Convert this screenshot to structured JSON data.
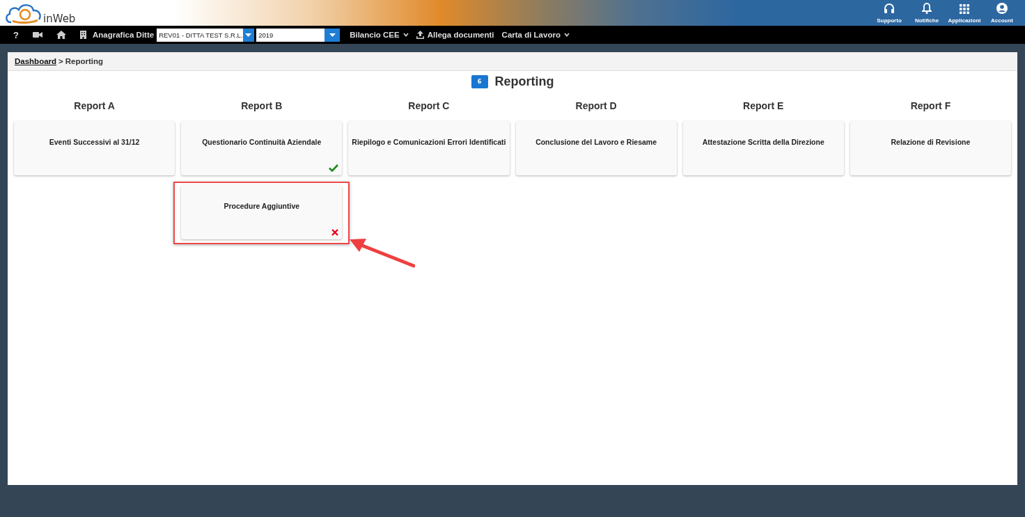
{
  "header": {
    "logo_text": "inWeb",
    "actions": [
      {
        "label": "Supporto",
        "kind": "headset"
      },
      {
        "label": "Notifiche",
        "kind": "bell"
      },
      {
        "label": "Applicazioni",
        "kind": "grid"
      },
      {
        "label": "Account",
        "kind": "account"
      }
    ]
  },
  "navbar": {
    "help": "?",
    "company_label": "Anagrafica Ditte",
    "company_select": "REV01 - DITTA TEST S.R.L.",
    "year_select": "2019",
    "menus": [
      {
        "label": "Bilancio CEE",
        "kind": "dropdown"
      },
      {
        "label": "Allega documenti",
        "kind": "upload"
      },
      {
        "label": "Carta di Lavoro",
        "kind": "dropdown"
      }
    ]
  },
  "breadcrumb": {
    "link": "Dashboard",
    "separator": ">",
    "current": "Reporting"
  },
  "page_title": {
    "badge": "6",
    "title": "Reporting"
  },
  "columns": [
    {
      "heading": "Report A",
      "cards": [
        {
          "title": "Eventi Successivi al 31/12",
          "completed": false,
          "failed": false,
          "highlighted": false
        }
      ]
    },
    {
      "heading": "Report B",
      "cards": [
        {
          "title": "Questionario Continuità Aziendale",
          "completed": true,
          "failed": false,
          "highlighted": false
        },
        {
          "title": "Procedure Aggiuntive",
          "completed": false,
          "failed": true,
          "highlighted": true
        }
      ]
    },
    {
      "heading": "Report C",
      "cards": [
        {
          "title": "Riepilogo e Comunicazioni Errori Identificati",
          "completed": false,
          "failed": false,
          "highlighted": false
        }
      ]
    },
    {
      "heading": "Report D",
      "cards": [
        {
          "title": "Conclusione del Lavoro e Riesame",
          "completed": false,
          "failed": false,
          "highlighted": false
        }
      ]
    },
    {
      "heading": "Report E",
      "cards": [
        {
          "title": "Attestazione Scritta della Direzione",
          "completed": false,
          "failed": false,
          "highlighted": false
        }
      ]
    },
    {
      "heading": "Report F",
      "cards": [
        {
          "title": "Relazione di Revisione",
          "completed": false,
          "failed": false,
          "highlighted": false
        }
      ]
    }
  ]
}
